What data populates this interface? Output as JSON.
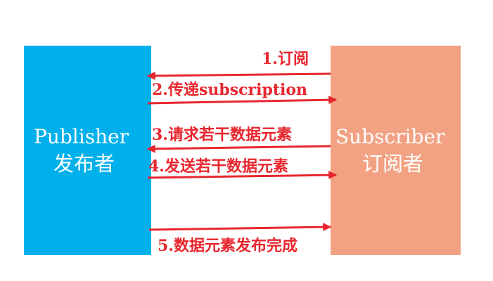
{
  "colors": {
    "publisher_box": "#00b0eb",
    "subscriber_box": "#f2a283",
    "arrow": "#e8262e",
    "text_light": "#ffffff"
  },
  "publisher": {
    "name": "Publisher",
    "name_cn": "发布者"
  },
  "subscriber": {
    "name": "Subscriber",
    "name_cn": "订阅者"
  },
  "messages": [
    {
      "label": "1.订阅",
      "direction": "to-publisher"
    },
    {
      "label": "2.传递subscription",
      "direction": "to-subscriber"
    },
    {
      "label": "3.请求若干数据元素",
      "direction": "to-publisher"
    },
    {
      "label": "4.发送若干数据元素",
      "direction": "to-subscriber"
    },
    {
      "label": "5.数据元素发布完成",
      "direction": "to-subscriber"
    }
  ]
}
